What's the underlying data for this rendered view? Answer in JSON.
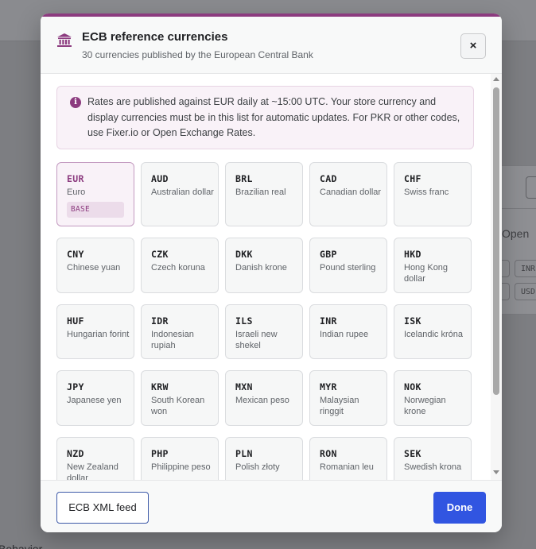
{
  "background": {
    "open_label": "Open",
    "chips": [
      "INR",
      "USD"
    ],
    "bottom_text": "Behavior"
  },
  "modal": {
    "title": "ECB reference currencies",
    "subtitle": "30 currencies published by the European Central Bank",
    "close_label": "×",
    "info_icon": "info-icon",
    "info_text": "Rates are published against EUR daily at ~15:00 UTC. Your store currency and display currencies must be in this list for automatic updates. For PKR or other codes, use Fixer.io or Open Exchange Rates.",
    "base_badge": "BASE",
    "currencies": [
      {
        "code": "EUR",
        "name": "Euro",
        "base": true
      },
      {
        "code": "AUD",
        "name": "Australian dollar"
      },
      {
        "code": "BRL",
        "name": "Brazilian real"
      },
      {
        "code": "CAD",
        "name": "Canadian dollar"
      },
      {
        "code": "CHF",
        "name": "Swiss franc"
      },
      {
        "code": "CNY",
        "name": "Chinese yuan"
      },
      {
        "code": "CZK",
        "name": "Czech koruna"
      },
      {
        "code": "DKK",
        "name": "Danish krone"
      },
      {
        "code": "GBP",
        "name": "Pound sterling"
      },
      {
        "code": "HKD",
        "name": "Hong Kong dollar"
      },
      {
        "code": "HUF",
        "name": "Hungarian forint"
      },
      {
        "code": "IDR",
        "name": "Indonesian rupiah"
      },
      {
        "code": "ILS",
        "name": "Israeli new shekel"
      },
      {
        "code": "INR",
        "name": "Indian rupee"
      },
      {
        "code": "ISK",
        "name": "Icelandic króna"
      },
      {
        "code": "JPY",
        "name": "Japanese yen"
      },
      {
        "code": "KRW",
        "name": "South Korean won"
      },
      {
        "code": "MXN",
        "name": "Mexican peso"
      },
      {
        "code": "MYR",
        "name": "Malaysian ringgit"
      },
      {
        "code": "NOK",
        "name": "Norwegian krone"
      },
      {
        "code": "NZD",
        "name": "New Zealand dollar"
      },
      {
        "code": "PHP",
        "name": "Philippine peso"
      },
      {
        "code": "PLN",
        "name": "Polish złoty"
      },
      {
        "code": "RON",
        "name": "Romanian leu"
      },
      {
        "code": "SEK",
        "name": "Swedish krona"
      }
    ],
    "footer": {
      "feed_label": "ECB XML feed",
      "done_label": "Done"
    }
  },
  "colors": {
    "accent": "#8c3b7f",
    "primary_button": "#3155e1",
    "info_background": "#f9f2f8"
  }
}
